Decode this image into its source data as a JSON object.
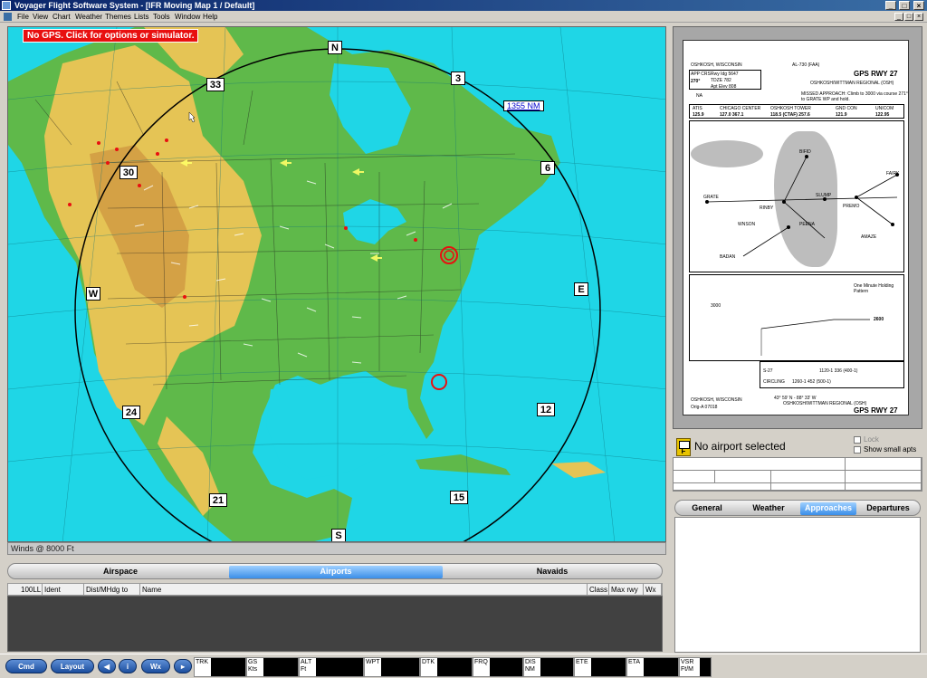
{
  "window": {
    "title": "Voyager Flight Software System - [IFR Moving Map 1 / Default]",
    "controls": {
      "minimize": "_",
      "maximize": "□",
      "close": "×"
    }
  },
  "menu": {
    "items": [
      "File",
      "View",
      "Chart",
      "Weather",
      "Themes",
      "Lists",
      "Tools",
      "Window",
      "Help"
    ],
    "mdi_controls": {
      "minimize": "_",
      "restore": "□",
      "close": "×"
    }
  },
  "map": {
    "gps_warning": "No GPS.  Click for options or simulator.",
    "range_label": "1355 NM",
    "compass": [
      "N",
      "3",
      "6",
      "E",
      "12",
      "15",
      "S",
      "21",
      "24",
      "W",
      "30",
      "33"
    ],
    "status": "Winds @ 8000 Ft",
    "colors": {
      "water": "#1fd6e6",
      "lowland": "#5fb94a",
      "highland": "#e5c455",
      "range_ring": "#000000",
      "marker": "#e81010"
    }
  },
  "bottom_panel": {
    "tabs": [
      "Airspace",
      "Airports",
      "Navaids"
    ],
    "active_tab": "Airports",
    "columns": [
      "100LL",
      "Ident",
      "Dist/MHdg to",
      "Name",
      "Class",
      "Max rwy",
      "Wx"
    ]
  },
  "footer": {
    "buttons": [
      "Cmd",
      "Layout"
    ],
    "info_icon": "i",
    "wx_button": "Wx",
    "instruments": [
      {
        "label": "TRK"
      },
      {
        "label": "GS\nKts"
      },
      {
        "label": "ALT\nFt"
      },
      {
        "label": "WPT"
      },
      {
        "label": "DTK"
      },
      {
        "label": "FRQ"
      },
      {
        "label": "DIS\nNM"
      },
      {
        "label": "ETE"
      },
      {
        "label": "ETA"
      },
      {
        "label": "VSR\nFt/M"
      }
    ]
  },
  "approach_plate": {
    "location": "OSHKOSH, WISCONSIN",
    "faa_ref": "AL-730 (FAA)",
    "procedure": "GPS RWY 27",
    "airport": "OSHKOSH/WITTMAN REGIONAL (OSH)",
    "app_crs_label": "APP CRS",
    "app_crs": "270°",
    "rwy_ldg": "Rwy Idg 5647",
    "tdze": "TDZE 782",
    "apt_elev": "Apt Elev 808",
    "na": "NA",
    "missed_approach": "MISSED APPROACH: Climb to 3000 via course 271° to GRATE WP and hold.",
    "freqs": [
      {
        "name": "ATIS",
        "value": "125.9"
      },
      {
        "name": "CHICAGO CENTER",
        "value": "127.0  367.1"
      },
      {
        "name": "OSHKOSH TOWER",
        "value": "118.5 (CTAF)  257.6"
      },
      {
        "name": "GND CON",
        "value": "121.9"
      },
      {
        "name": "UNICOM",
        "value": "122.95"
      }
    ],
    "fixes": [
      "BIFID",
      "GRATE",
      "RINBY",
      "SLUMP",
      "PREMO",
      "FAIRK",
      "AMAZE",
      "WNSON",
      "PEENA",
      "BADAN"
    ],
    "minimums": [
      {
        "category": "S-27",
        "value": "1120-1  336 (400-1)"
      },
      {
        "category": "CIRCLING",
        "value": "1260-1  452 (500-1)"
      }
    ],
    "holding_note": "One Minute Holding Pattern",
    "profile_alts": [
      "3000",
      "2600"
    ],
    "footer_left": "Orig-A 07018",
    "coords": "43° 59' N - 88° 33' W"
  },
  "airport_panel": {
    "title": "No airport selected",
    "lock_label": "Lock",
    "show_small_label": "Show small apts",
    "tabs": [
      "General",
      "Weather",
      "Approaches",
      "Departures"
    ],
    "active_tab": "Approaches"
  }
}
